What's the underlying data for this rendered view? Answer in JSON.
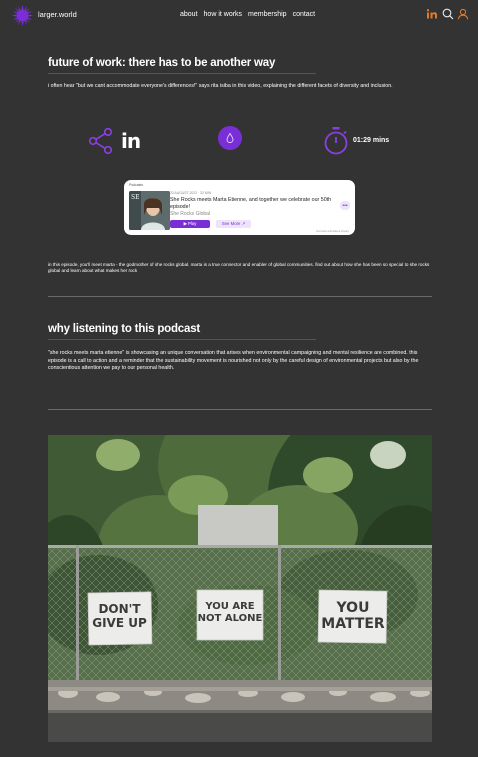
{
  "header": {
    "logo_text": "larger.world",
    "nav": [
      "about",
      "how it works",
      "membership",
      "contact"
    ]
  },
  "episode": {
    "title": "future of work: there has to be another way",
    "intro": "i often hear \"but we cant accommodate everyone's differences!\" says rita isiba in this video, explaining the different facets of diversity and inclusion.",
    "duration": "01:29 mins",
    "description": "in this episode, you'll meet marta - the godmother of she rocks global. marta is a true connector and enabler of global communities. find out about how she has been so special to she rocks global and learn about what makes her rock"
  },
  "podcast_card": {
    "brand": "Podcasts",
    "date": "23 AUGUST 2022 · 32 MIN",
    "title": "She Rocks meets Marta Etienne, and together we celebrate our 50th episode!",
    "show": "She Rocks Global",
    "play_label": "▶ Play",
    "see_more_label": "See More ↗",
    "privacy": "Overview and data & privacy",
    "thumb_text": "SE"
  },
  "why": {
    "title": "why listening to this podcast",
    "body": "\"she rocks meets marta etienne\" is showcasing an unique conversation that arises when environmental campaigning and mental resilience are combined. this episode is a call to action and a reminder that the sustainability movement is nourished not only by the careful design of environmental projects but also by the conscientious attention we pay to our personal health."
  },
  "photo_signs": {
    "sign1": [
      "DON'T",
      "GIVE UP"
    ],
    "sign2": [
      "YOU ARE",
      "NOT ALONE"
    ],
    "sign3": [
      "YOU",
      "MATTER"
    ]
  },
  "colors": {
    "background": "#333333",
    "accent_purple": "#7a2fd6",
    "accent_orange": "#e07a2e",
    "underline": "#8a4030"
  },
  "icons": {
    "logo": "sunburst-logo-icon",
    "linkedin": "linkedin-icon",
    "search": "search-icon",
    "user": "user-icon",
    "share": "share-icon",
    "timer": "stopwatch-icon"
  }
}
